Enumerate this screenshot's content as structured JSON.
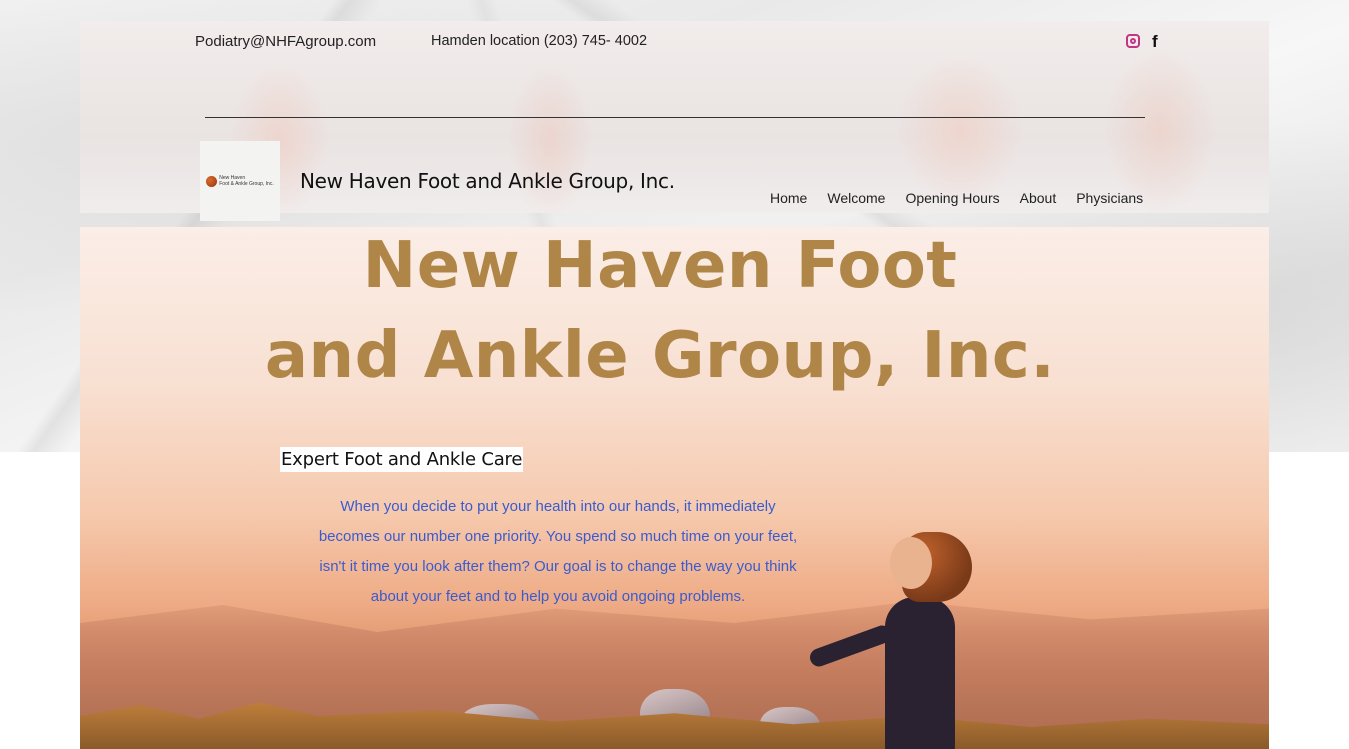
{
  "header": {
    "email": "Podiatry@NHFAgroup.com",
    "phone": "Hamden location (203) 745- 4002",
    "brand": "New Haven Foot and Ankle Group, Inc.",
    "logo_text": "New Haven\nFoot & Ankle Group, Inc.",
    "social": [
      {
        "icon": "instagram-icon"
      },
      {
        "icon": "facebook-icon"
      }
    ]
  },
  "nav": {
    "items": [
      "Home",
      "Welcome",
      "Opening Hours",
      "About",
      "Physicians"
    ]
  },
  "hero": {
    "title_line1": "New Haven Foot",
    "title_line2": "and Ankle Group, Inc.",
    "subtitle": "Expert Foot and Ankle Care",
    "paragraph": "When you decide to put your health into our hands, it immediately becomes our number one priority. You spend so much time on your feet, isn't it time you look after them? Our goal is to change the way you think about your feet and to help you avoid ongoing problems."
  },
  "colors": {
    "title": "#b08648",
    "paragraph": "#3a5bd0",
    "instagram": "#c13584"
  }
}
